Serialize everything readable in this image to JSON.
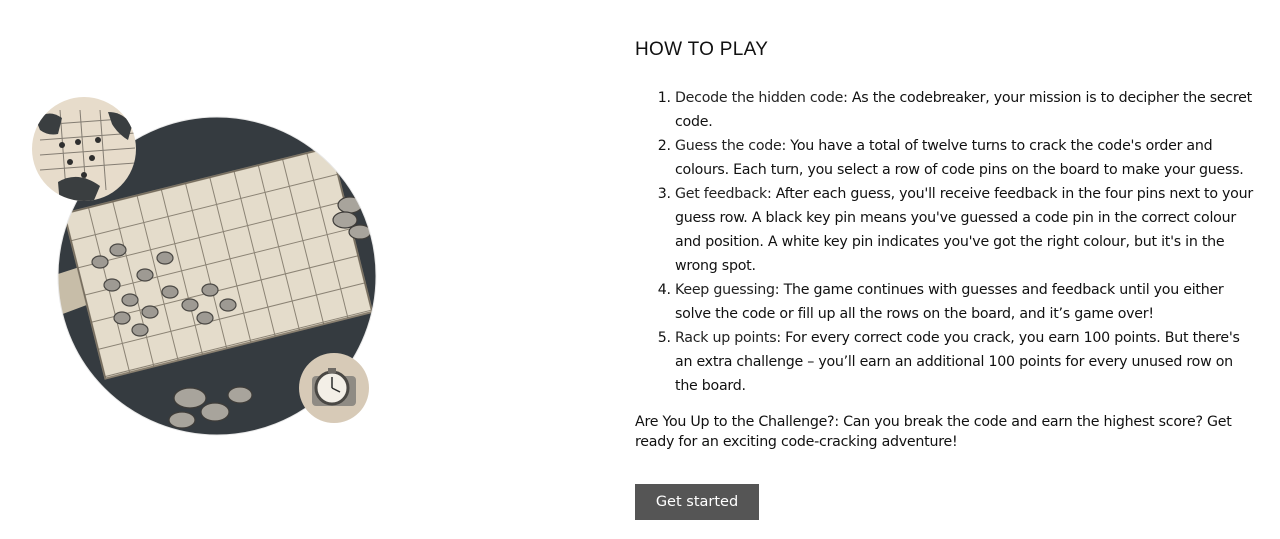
{
  "heading": "HOW TO PLAY",
  "steps": [
    {
      "title": "Decode the hidden code",
      "text": ": As the codebreaker, your mission is to decipher the secret code."
    },
    {
      "title": "Guess the code",
      "text": ": You have a total of twelve turns to crack the code's order and colours. Each turn, you select a row of code pins on the board to make your guess."
    },
    {
      "title": "Get feedback",
      "text": ": After each guess, you'll receive feedback in the four pins next to your guess row. A black key pin means you've guessed a code pin in the correct colour and position. A white key pin indicates you've got the right colour, but it's in the wrong spot."
    },
    {
      "title": "Keep guessing",
      "text": ": The game continues with guesses and feedback until you either solve the code or fill up all the rows on the board, and it’s game over!"
    },
    {
      "title": "Rack up points",
      "text": ": For every correct code you crack, you earn 100 points. But there's an extra challenge – you’ll earn an additional 100 points for every unused row on the board."
    }
  ],
  "outro": "Are You Up to the Challenge?: Can you break the code and earn the highest score? Get ready for an exciting code-cracking adventure!",
  "cta_label": "Get started",
  "colors": {
    "button_bg": "#555555",
    "button_text": "#ffffff"
  },
  "illustration_icons": [
    "board-illustration",
    "hands-icon",
    "stopwatch-icon"
  ]
}
